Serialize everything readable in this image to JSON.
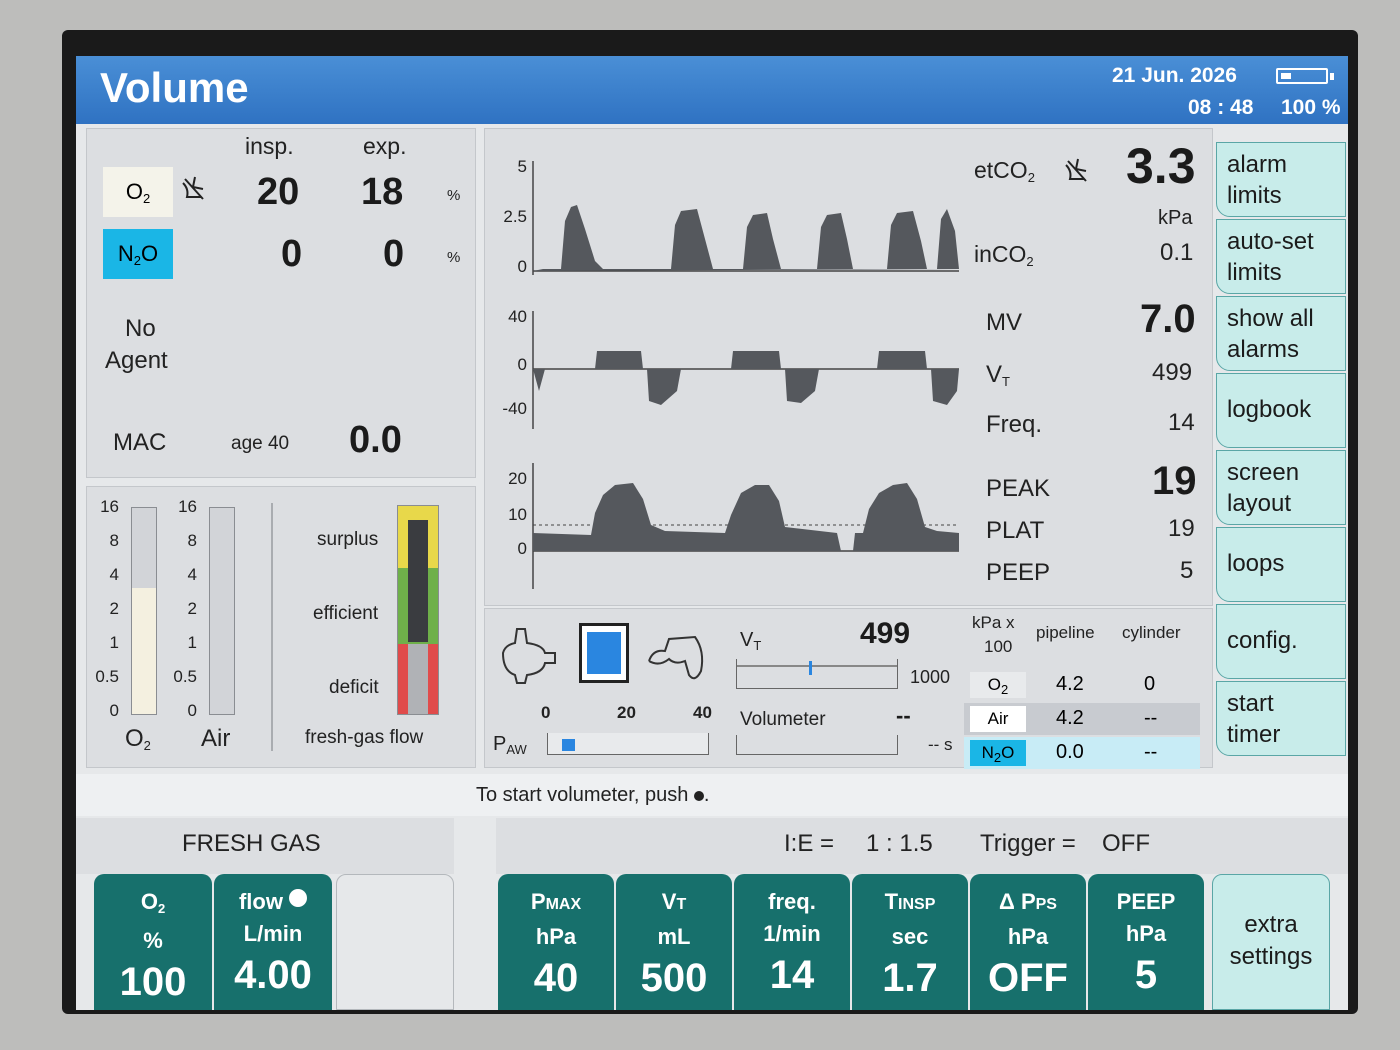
{
  "header": {
    "mode": "Volume",
    "date": "21 Jun. 2026",
    "time": "08 : 48",
    "battery_text": "100 %"
  },
  "gas_table": {
    "insp_label": "insp.",
    "exp_label": "exp.",
    "o2_label": "O",
    "o2_sub": "2",
    "o2_insp": "20",
    "o2_exp": "18",
    "pct": "%",
    "n2o_label_a": "N",
    "n2o_sub": "2",
    "n2o_label_b": "O",
    "n2o_insp": "0",
    "n2o_exp": "0",
    "agent_line1": "No",
    "agent_line2": "Agent",
    "mac_label": "MAC",
    "age_label": "age 40",
    "mac_value": "0.0"
  },
  "flowmeters": {
    "scale_ticks": [
      "16",
      "8",
      "4",
      "2",
      "1",
      "0.5",
      "0"
    ],
    "o2_label": "O",
    "o2_sub": "2",
    "air_label": "Air",
    "o2_fill_fraction": 0.62,
    "air_fill_fraction": 0.0,
    "surplus_label": "surplus",
    "efficient_label": "efficient",
    "deficit_label": "deficit",
    "fresh_gas_flow_label": "fresh-gas flow",
    "colors": {
      "surplus": "#e8d84a",
      "efficient": "#6fb04a",
      "deficit": "#e04b4b"
    }
  },
  "waveforms": {
    "co2_ticks": [
      "5",
      "2.5",
      "0"
    ],
    "flow_ticks": [
      "40",
      "0",
      "-40"
    ],
    "paw_ticks": [
      "20",
      "10",
      "0"
    ]
  },
  "measurements": {
    "etco2_label": "etCO",
    "etco2_sub": "2",
    "etco2_value": "3.3",
    "etco2_unit": "kPa",
    "inco2_label": "inCO",
    "inco2_sub": "2",
    "inco2_value": "0.1",
    "mv_label": "MV",
    "mv_value": "7.0",
    "vt_label": "V",
    "vt_sub": "T",
    "vt_value": "499",
    "freq_label": "Freq.",
    "freq_value": "14",
    "peak_label": "PEAK",
    "peak_value": "19",
    "plat_label": "PLAT",
    "plat_value": "19",
    "peep_label": "PEEP",
    "peep_value": "5"
  },
  "side_menu": [
    {
      "line1": "alarm",
      "line2": "limits"
    },
    {
      "line1": "auto-set",
      "line2": "limits"
    },
    {
      "line1": "show all",
      "line2": "alarms"
    },
    {
      "line1": "logbook",
      "line2": ""
    },
    {
      "line1": "screen",
      "line2": "layout"
    },
    {
      "line1": "loops",
      "line2": ""
    },
    {
      "line1": "config.",
      "line2": ""
    },
    {
      "line1": "start",
      "line2": "timer"
    }
  ],
  "paw_gauge": {
    "label": "P",
    "label_sub": "AW",
    "ticks": [
      "0",
      "20",
      "40"
    ],
    "fill_fraction": 0.08
  },
  "vt_meter": {
    "label": "V",
    "label_sub": "T",
    "value": "499",
    "max": "1000",
    "fraction": 0.45,
    "volumeter_label": "Volumeter",
    "volumeter_value": "--",
    "volumeter_unit": "-- s"
  },
  "supply": {
    "unit_line1": "kPa x",
    "unit_line2": "100",
    "pipeline_label": "pipeline",
    "cylinder_label": "cylinder",
    "rows": [
      {
        "gas": "O",
        "gas_sub": "2",
        "gas_tail": "",
        "pipeline": "4.2",
        "cylinder": "0"
      },
      {
        "gas": "Air",
        "gas_sub": "",
        "gas_tail": "",
        "pipeline": "4.2",
        "cylinder": "--"
      },
      {
        "gas": "N",
        "gas_sub": "2",
        "gas_tail": "O",
        "pipeline": "0.0",
        "cylinder": "--"
      }
    ]
  },
  "message": {
    "text": "To start volumeter, push",
    "tail": "."
  },
  "fresh_gas": {
    "title": "FRESH GAS",
    "o2_label": "O",
    "o2_sub": "2",
    "o2_unit": "%",
    "o2_value": "100",
    "flow_label": "flow",
    "flow_unit": "L/min",
    "flow_value": "4.00"
  },
  "vent_status": {
    "ie_label": "I:E =",
    "ie_value": "1 : 1.5",
    "trigger_label": "Trigger =",
    "trigger_value": "OFF"
  },
  "vent_settings": [
    {
      "name": "P",
      "name_small": "MAX",
      "unit": "hPa",
      "value": "40"
    },
    {
      "name": "V",
      "name_small": "T",
      "unit": "mL",
      "value": "500"
    },
    {
      "name": "freq.",
      "name_small": "",
      "unit": "1/min",
      "value": "14"
    },
    {
      "name": "T",
      "name_small": "INSP",
      "unit": "sec",
      "value": "1.7"
    },
    {
      "name": "Δ P",
      "name_small": "PS",
      "unit": "hPa",
      "value": "OFF"
    },
    {
      "name": "PEEP",
      "name_small": "",
      "unit": "hPa",
      "value": "5"
    }
  ],
  "extra_settings": {
    "line1": "extra",
    "line2": "settings"
  }
}
